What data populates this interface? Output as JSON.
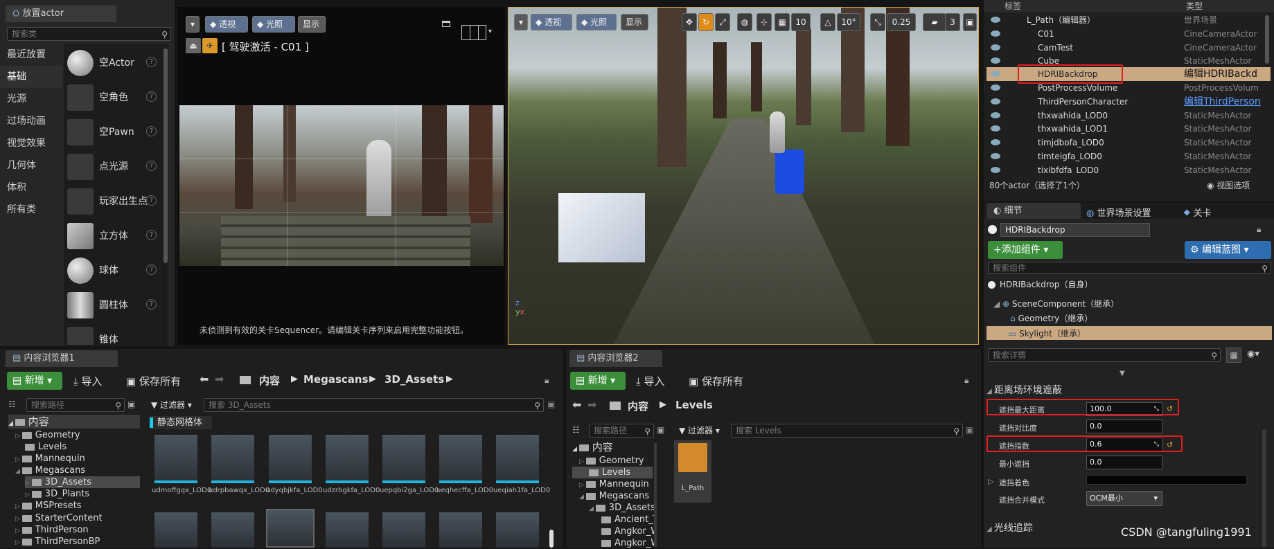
{
  "place_actors": {
    "tab": "放置actor",
    "search_placeholder": "搜索类",
    "categories": [
      "最近放置",
      "基础",
      "光源",
      "过场动画",
      "视觉效果",
      "几何体",
      "体积",
      "所有类"
    ],
    "items": [
      "空Actor",
      "空角色",
      "空Pawn",
      "点光源",
      "玩家出生点",
      "立方体",
      "球体",
      "圆柱体",
      "锥体"
    ]
  },
  "cine_viewport": {
    "perspective": "透视",
    "lit": "光照",
    "show": "显示",
    "pilot_label": "[ 驾驶激活 - C01 ]",
    "message": "未侦测到有效的关卡Sequencer。请编辑关卡序列来启用完整功能按钮。"
  },
  "main_viewport": {
    "perspective": "透视",
    "lit": "光照",
    "show": "显示",
    "grid": "10",
    "angle": "10°",
    "scale": "0.25",
    "cam_speed": "3"
  },
  "outliner": {
    "col_label": "标签",
    "col_type": "类型",
    "footer": "80个actor（选择了1个）",
    "view_options": "视图选项",
    "rows": [
      {
        "name": "L_Path（编辑器）",
        "type": "世界场景"
      },
      {
        "name": "C01",
        "type": "CineCameraActor"
      },
      {
        "name": "CamTest",
        "type": "CineCameraActor"
      },
      {
        "name": "Cube",
        "type": "StaticMeshActor"
      },
      {
        "name": "HDRIBackdrop",
        "type": "编辑HDRIBackd"
      },
      {
        "name": "PostProcessVolume",
        "type": "PostProcessVolum"
      },
      {
        "name": "ThirdPersonCharacter",
        "type": "编辑ThirdPerson"
      },
      {
        "name": "thxwahida_LOD0",
        "type": "StaticMeshActor"
      },
      {
        "name": "thxwahida_LOD1",
        "type": "StaticMeshActor"
      },
      {
        "name": "timjdbofa_LOD0",
        "type": "StaticMeshActor"
      },
      {
        "name": "timteigfa_LOD0",
        "type": "StaticMeshActor"
      },
      {
        "name": "tixibfdfa_LOD0",
        "type": "StaticMeshActor"
      }
    ]
  },
  "details": {
    "tabs": [
      "细节",
      "世界场景设置",
      "关卡"
    ],
    "actor_name": "HDRIBackdrop",
    "add_component": "+添加组件",
    "edit_blueprint": "编辑蓝图",
    "search_components": "搜索组件",
    "self_label": "HDRIBackdrop（自身）",
    "components": [
      "SceneComponent（继承）",
      "Geometry（继承）",
      "Skylight（继承）"
    ],
    "search_details": "搜索详情",
    "section1": "距离场环境遮蔽",
    "props": [
      {
        "label": "遮挡最大距离",
        "value": "100.0"
      },
      {
        "label": "遮挡对比度",
        "value": "0.0"
      },
      {
        "label": "遮挡指数",
        "value": "0.6"
      },
      {
        "label": "最小遮挡",
        "value": "0.0"
      },
      {
        "label": "遮挡着色",
        "value": ""
      },
      {
        "label": "遮挡合并模式",
        "value": "OCM最小"
      }
    ],
    "section2": "光线追踪",
    "watermark": "CSDN @tangfuling1991"
  },
  "cb1": {
    "tab": "内容浏览器1",
    "new": "新增",
    "import": "导入",
    "save_all": "保存所有",
    "crumbs": [
      "内容",
      "Megascans",
      "3D_Assets"
    ],
    "search_path": "搜索路径",
    "filter": "过滤器",
    "search_assets": "搜索 3D_Assets",
    "type_chip": "静态网格体",
    "root": "内容",
    "tree": [
      "Geometry",
      "Levels",
      "Mannequin",
      "Megascans",
      "3D_Assets",
      "3D_Plants",
      "MSPresets",
      "StarterContent",
      "ThirdPerson",
      "ThirdPersonBP"
    ],
    "assets": [
      "udmoffgqx_LOD0",
      "udrpbawqx_LOD0",
      "udyqbjkfa_LOD0",
      "udzrbgkfa_LOD0",
      "uepqbi2ga_LOD0",
      "ueqhecffa_LOD0",
      "ueqiah1fa_LOD0"
    ]
  },
  "cb2": {
    "tab": "内容浏览器2",
    "new": "新增",
    "import": "导入",
    "save_all": "保存所有",
    "crumbs": [
      "内容",
      "Levels"
    ],
    "search_path": "搜索路径",
    "filter": "过滤器",
    "search_assets": "搜索 Levels",
    "root": "内容",
    "tree": [
      "Geometry",
      "Levels",
      "Mannequin",
      "Megascans",
      "3D_Assets",
      "Ancient_T",
      "Angkor_W",
      "Angkor_W"
    ],
    "asset": "L_Path"
  }
}
